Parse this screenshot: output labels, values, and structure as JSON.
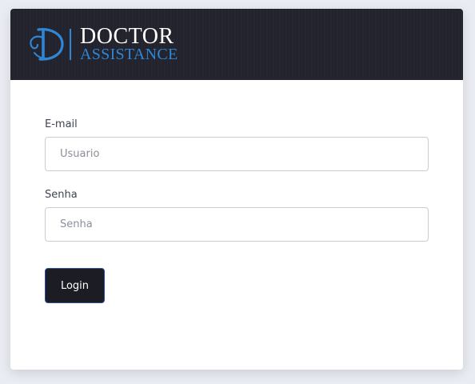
{
  "brand": {
    "line1": "DOCTOR",
    "line2": "ASSISTANCE",
    "colors": {
      "primary": "#ffffff",
      "accent": "#2f86d6",
      "header_bg": "#22232d"
    }
  },
  "form": {
    "email": {
      "label": "E-mail",
      "placeholder": "Usuario",
      "value": ""
    },
    "password": {
      "label": "Senha",
      "placeholder": "Senha",
      "value": ""
    },
    "submit_label": "Login"
  },
  "colors": {
    "button_bg": "#1c1c24",
    "button_border": "#2b4fa0",
    "page_bg": "#e9ecf2"
  }
}
